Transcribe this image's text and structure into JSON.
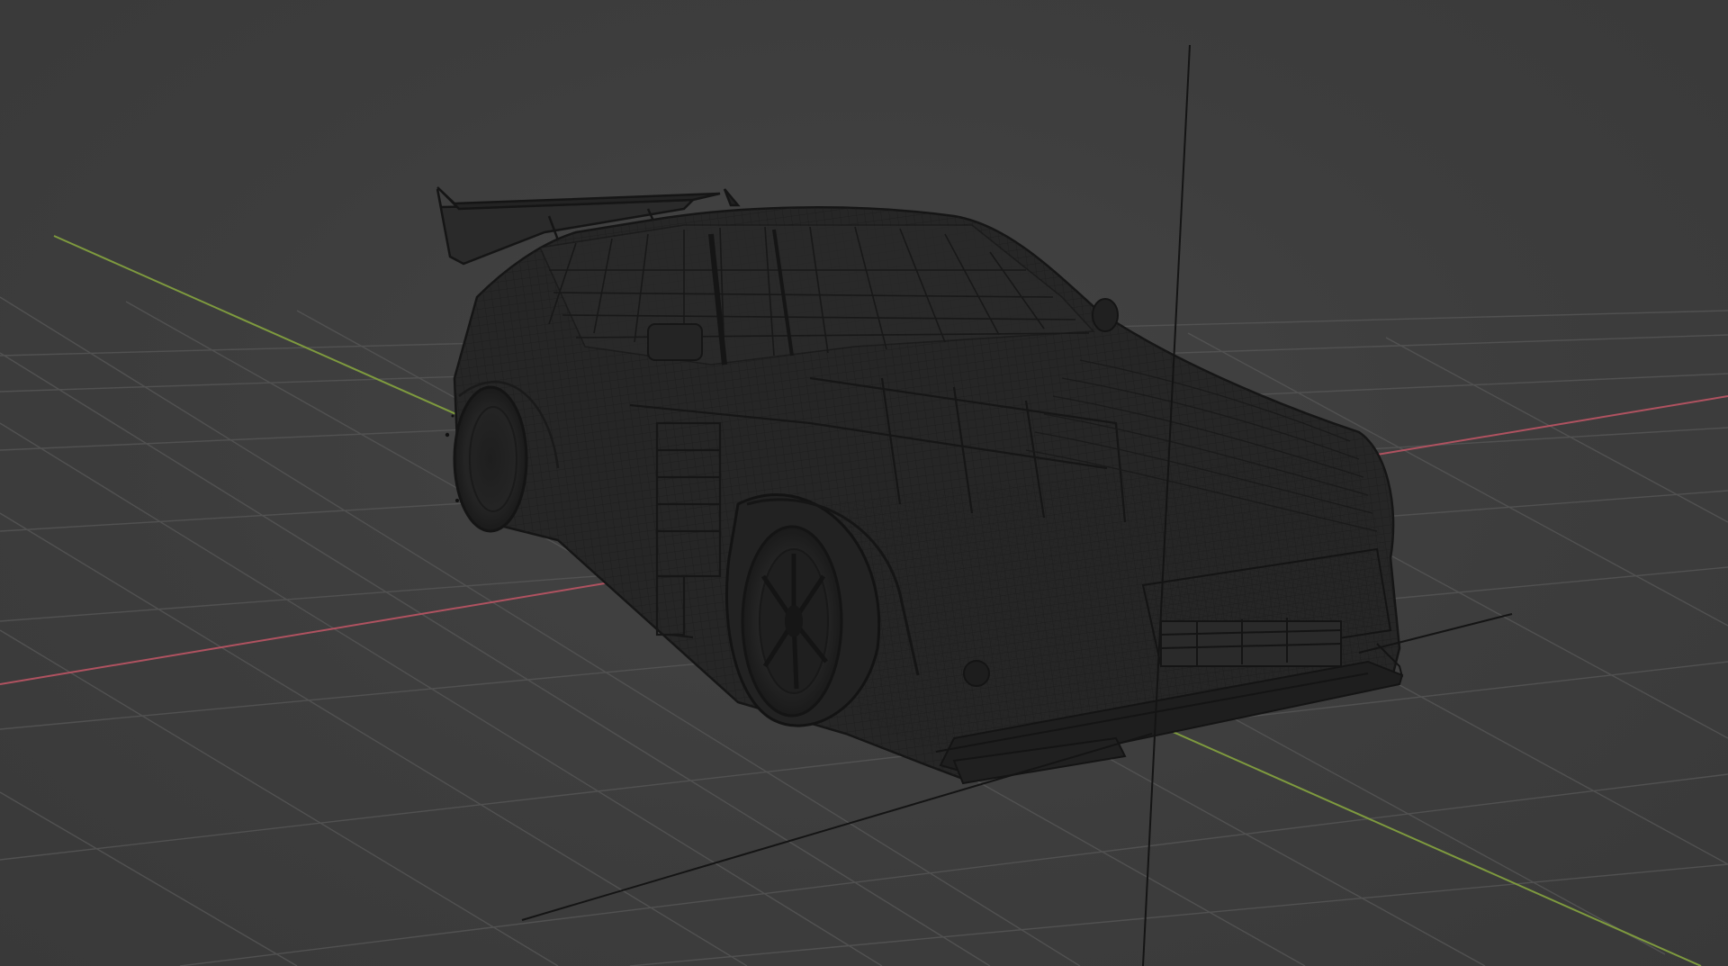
{
  "viewport": {
    "mode": "wireframe",
    "view": "perspective",
    "show_floor_grid": true,
    "show_axes": [
      "x",
      "y",
      "z"
    ]
  },
  "scene": {
    "object": {
      "name_hint": "car-body",
      "kind": "hatchback race car with rear wing",
      "display": "wireframe"
    },
    "empty_axes_visible": true
  },
  "colors": {
    "background": "#3d3d3d",
    "grid_line": "#545454",
    "x_axis": "#b05260",
    "y_axis": "#7e9a3e",
    "z_axis": "#141414",
    "wire_dark": "#1c1c1c",
    "wire_light": "#2a2a2a",
    "body_fill": "#262626"
  }
}
